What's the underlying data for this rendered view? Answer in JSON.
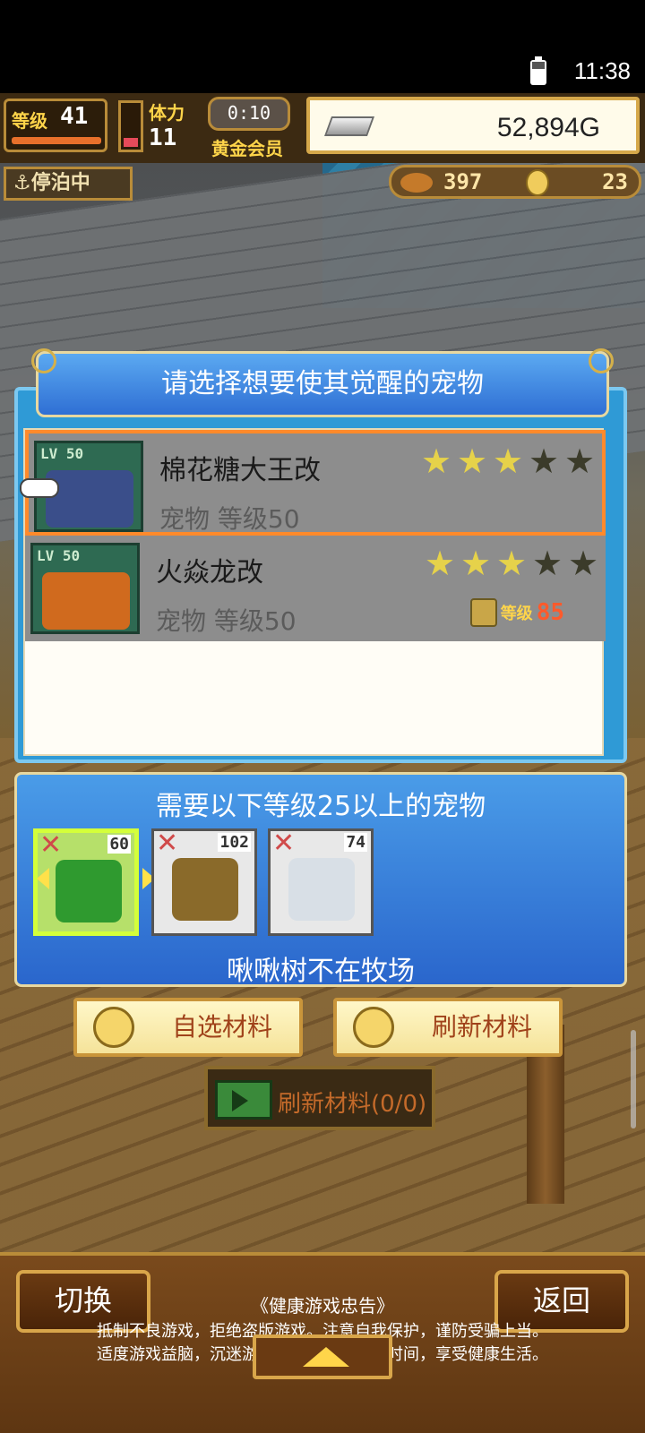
{
  "status_bar": {
    "time": "11:38",
    "battery_icon": "battery-icon"
  },
  "hud": {
    "level_label": "等级",
    "level_value": "41",
    "stamina_label": "体力",
    "stamina_value": "11",
    "timer": "0:10",
    "vip_label": "黄金会员",
    "gold": "52,894G",
    "docked_label": "停泊中",
    "food_count": "397",
    "medal_count": "23"
  },
  "dialog": {
    "title": "请选择想要使其觉醒的宠物",
    "pets": [
      {
        "name": "棉花糖大王改",
        "subtitle": "宠物 等级50",
        "level_badge": "LV 50",
        "stars_filled": 3,
        "stars_total": 5,
        "selected": true,
        "color": "#3a4e8a"
      },
      {
        "name": "火焱龙改",
        "subtitle": "宠物 等级50",
        "level_badge": "LV 50",
        "stars_filled": 3,
        "stars_total": 5,
        "selected": false,
        "lock_label": "等级",
        "lock_level": "85",
        "color": "#d06a1e"
      }
    ]
  },
  "requirement": {
    "title": "需要以下等级25以上的宠物",
    "materials": [
      {
        "count": "60",
        "color": "#2f9a2f",
        "selected": true
      },
      {
        "count": "102",
        "color": "#8a6a2a",
        "selected": false
      },
      {
        "count": "74",
        "color": "#d8dfe6",
        "selected": false
      }
    ],
    "footer": "啾啾树不在牧场"
  },
  "buttons": {
    "select_material": "自选材料",
    "refresh_material": "刷新材料",
    "video_refresh": "刷新材料(0/0)",
    "switch": "切换",
    "back": "返回"
  },
  "notice": {
    "title": "《健康游戏忠告》",
    "line1": "抵制不良游戏，拒绝盗版游戏。注意自我保护，谨防受骗上当。",
    "line2": "适度游戏益脑，沉迷游戏伤身。合理安排时间，享受健康生活。"
  },
  "colors": {
    "dialog_blue": "#2f9ad6",
    "selection_orange": "#ff8a2b",
    "gold": "#ffd54a"
  }
}
